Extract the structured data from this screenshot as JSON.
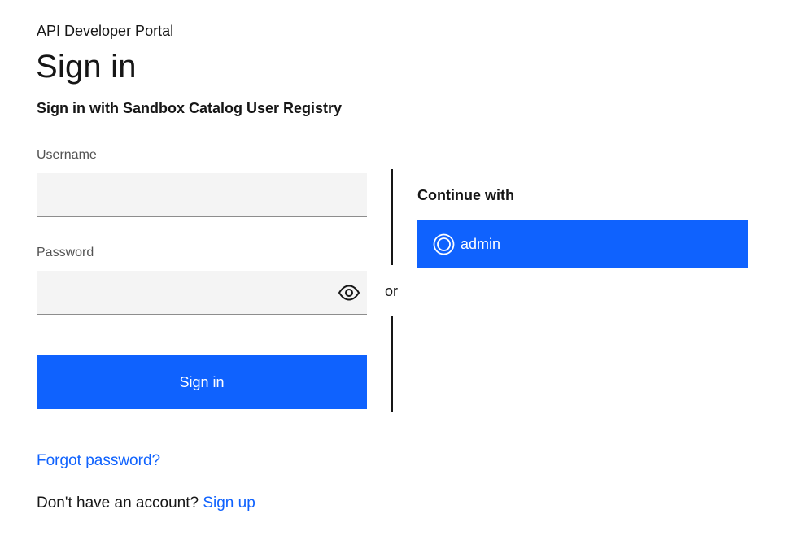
{
  "header": {
    "app_title": "API Developer Portal",
    "page_title": "Sign in",
    "registry_title": "Sign in with Sandbox Catalog User Registry"
  },
  "form": {
    "username_label": "Username",
    "username_value": "",
    "password_label": "Password",
    "password_value": "",
    "password_toggle_icon": "eye-icon",
    "submit_label": "Sign in"
  },
  "divider": {
    "text": "or"
  },
  "providers": {
    "title": "Continue with",
    "items": [
      {
        "label": "admin",
        "icon": "user-circle-icon"
      }
    ]
  },
  "footer": {
    "forgot_password": "Forgot password?",
    "no_account_text": "Don't have an account?",
    "sign_up": "Sign up"
  },
  "colors": {
    "primary": "#0f62fe",
    "text": "#161616",
    "label": "#525252",
    "field_bg": "#f4f4f4",
    "field_border": "#8d8d8d"
  }
}
